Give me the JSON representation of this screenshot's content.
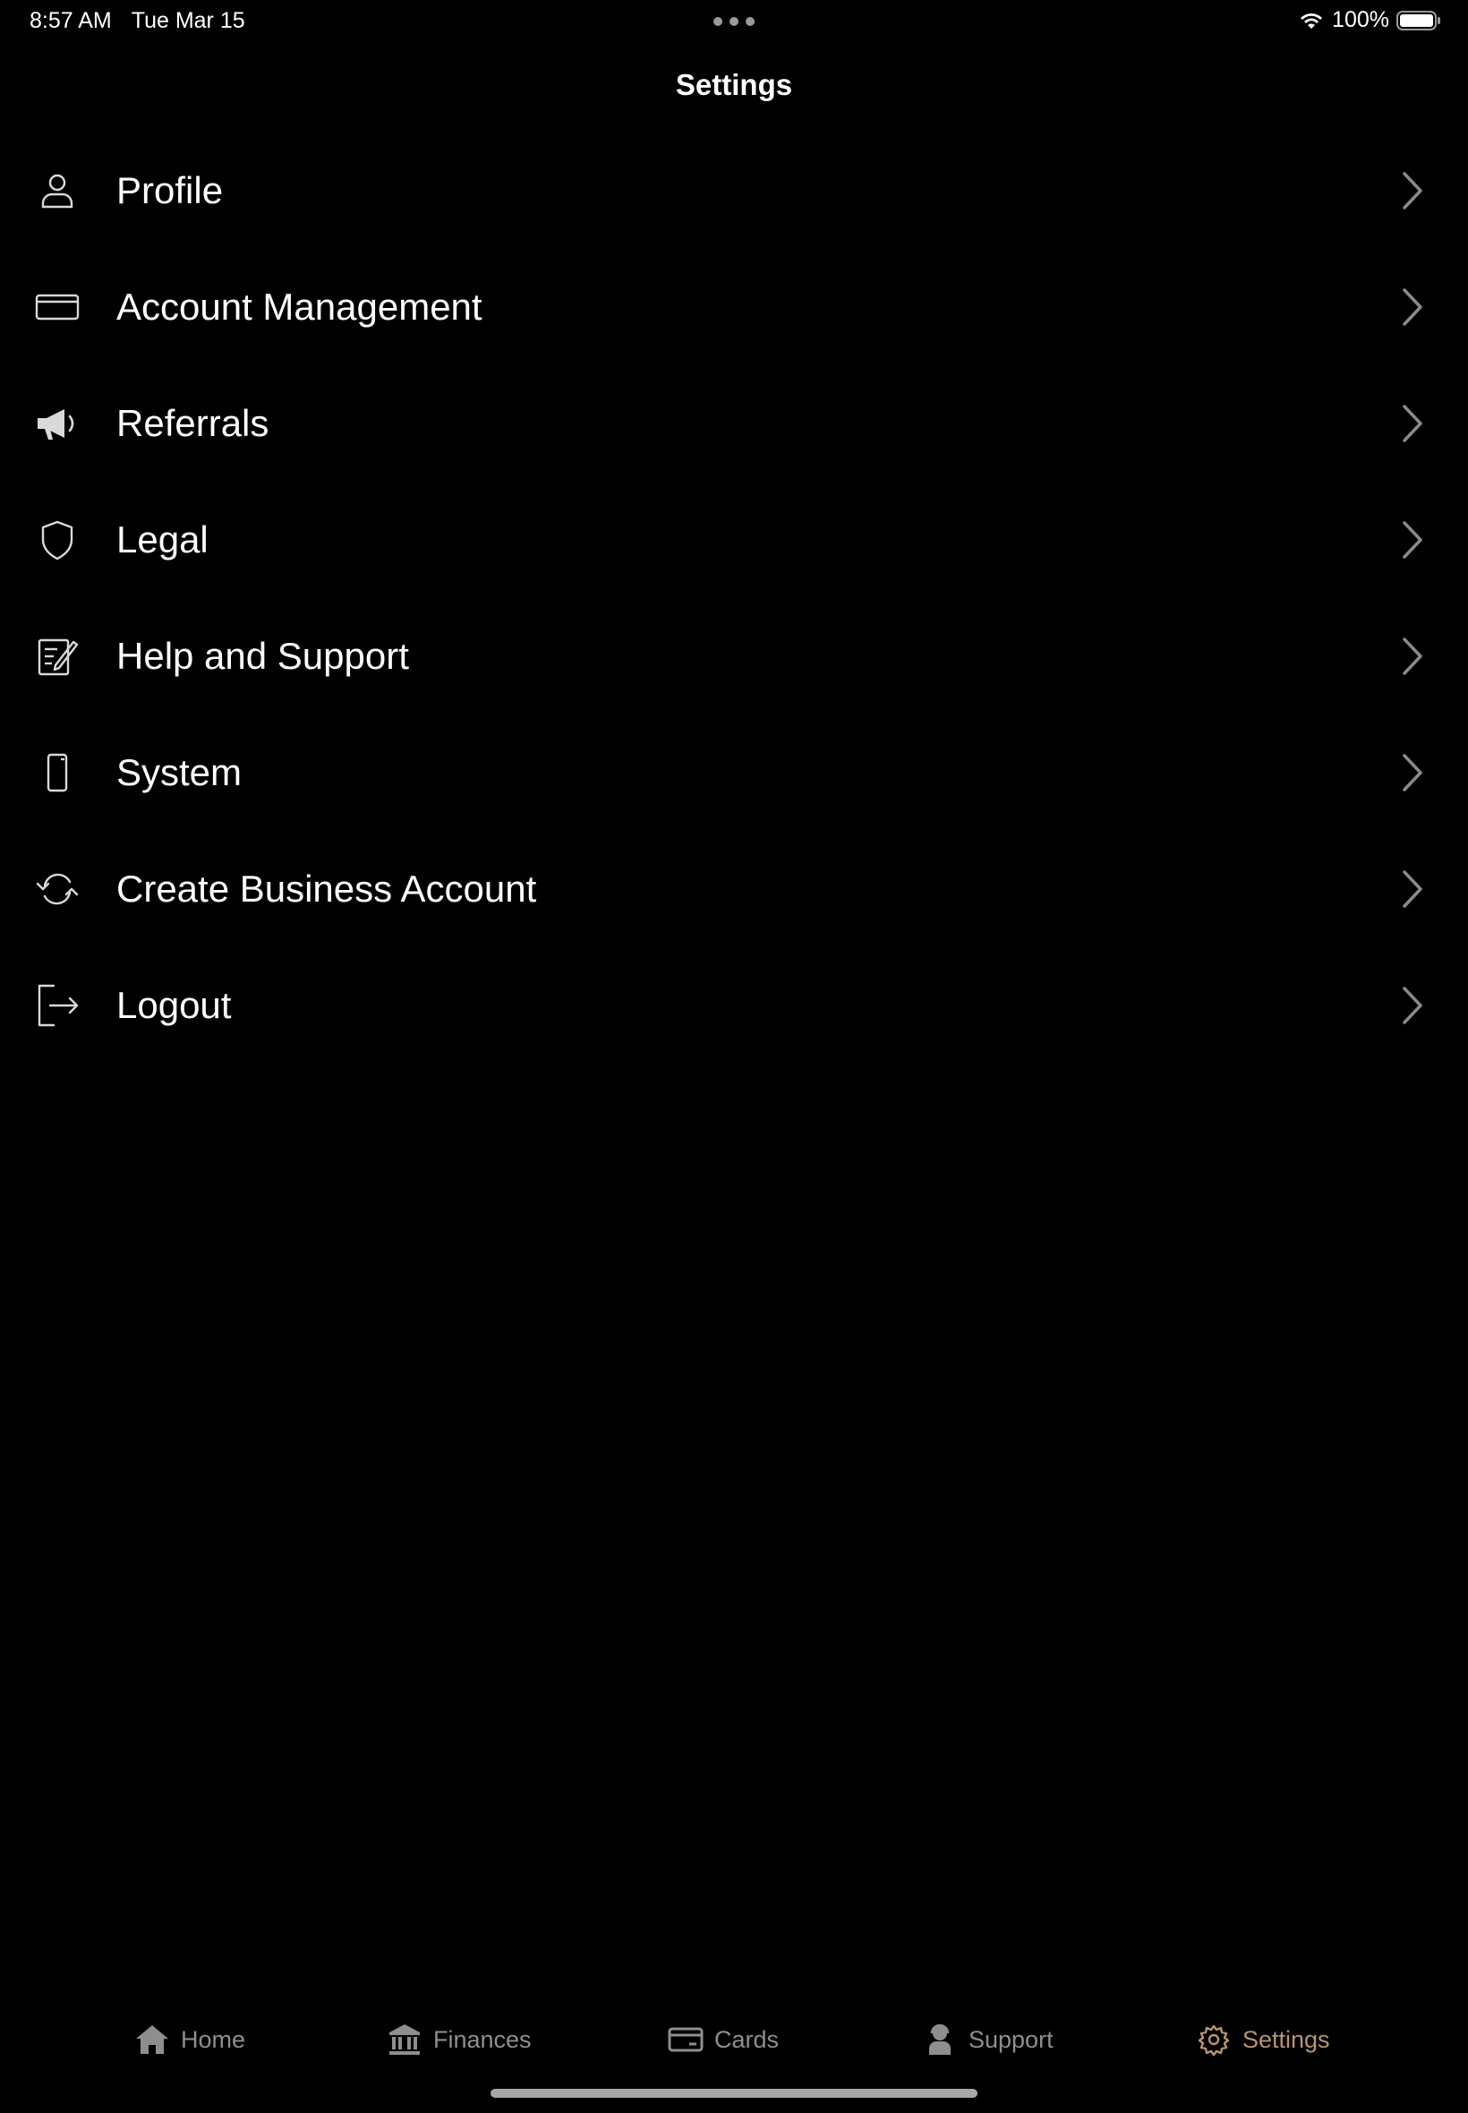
{
  "status_bar": {
    "time": "8:57 AM",
    "date": "Tue Mar 15",
    "battery": "100%"
  },
  "header": {
    "title": "Settings"
  },
  "settings": {
    "items": [
      {
        "label": "Profile",
        "icon": "person-icon"
      },
      {
        "label": "Account Management",
        "icon": "credit-card-icon"
      },
      {
        "label": "Referrals",
        "icon": "megaphone-icon"
      },
      {
        "label": "Legal",
        "icon": "shield-icon"
      },
      {
        "label": "Help and Support",
        "icon": "note-edit-icon"
      },
      {
        "label": "System",
        "icon": "phone-icon"
      },
      {
        "label": "Create Business Account",
        "icon": "sync-icon"
      },
      {
        "label": "Logout",
        "icon": "logout-icon"
      }
    ]
  },
  "tab_bar": {
    "tabs": [
      {
        "label": "Home",
        "icon": "house-icon",
        "active": false
      },
      {
        "label": "Finances",
        "icon": "bank-icon",
        "active": false
      },
      {
        "label": "Cards",
        "icon": "card-icon",
        "active": false
      },
      {
        "label": "Support",
        "icon": "agent-icon",
        "active": false
      },
      {
        "label": "Settings",
        "icon": "gear-icon",
        "active": true
      }
    ]
  },
  "colors": {
    "background": "#000000",
    "text": "#ffffff",
    "icon": "#d9d9d9",
    "chevron": "#8a8a8a",
    "tab_inactive": "#8e8e8e",
    "tab_active": "#b69470"
  }
}
